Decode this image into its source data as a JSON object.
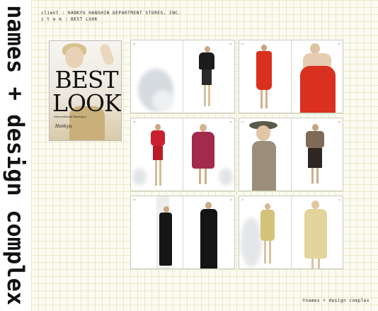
{
  "brand": {
    "vertical_name": "names + design complex",
    "footer": "©names + design complex"
  },
  "meta": {
    "client_line": "client : HANKYU HANSHIN DEPARTMENT STORES, INC.",
    "item_line": "i t e m : BEST LOOK"
  },
  "cover": {
    "title_line1": "BEST",
    "title_line2": "LOOK",
    "subtitle": "International Boutique",
    "logo_text": "Hankyu"
  },
  "spreads": [
    {
      "id": "spread-1",
      "left_page": "01",
      "right_page": "02"
    },
    {
      "id": "spread-2",
      "left_page": "03",
      "right_page": "04"
    },
    {
      "id": "spread-3",
      "left_page": "05",
      "right_page": "06"
    },
    {
      "id": "spread-4",
      "left_page": "07",
      "right_page": "08"
    },
    {
      "id": "spread-5",
      "left_page": "09",
      "right_page": "10"
    },
    {
      "id": "spread-6",
      "left_page": "11",
      "right_page": "12"
    }
  ],
  "colors": {
    "grid_line": "#e9e8c4",
    "grid_bg": "#fbfbf2",
    "red_dress": "#d9301f",
    "magenta_dress": "#a32a4a",
    "gold_dress": "#d4c27a"
  }
}
